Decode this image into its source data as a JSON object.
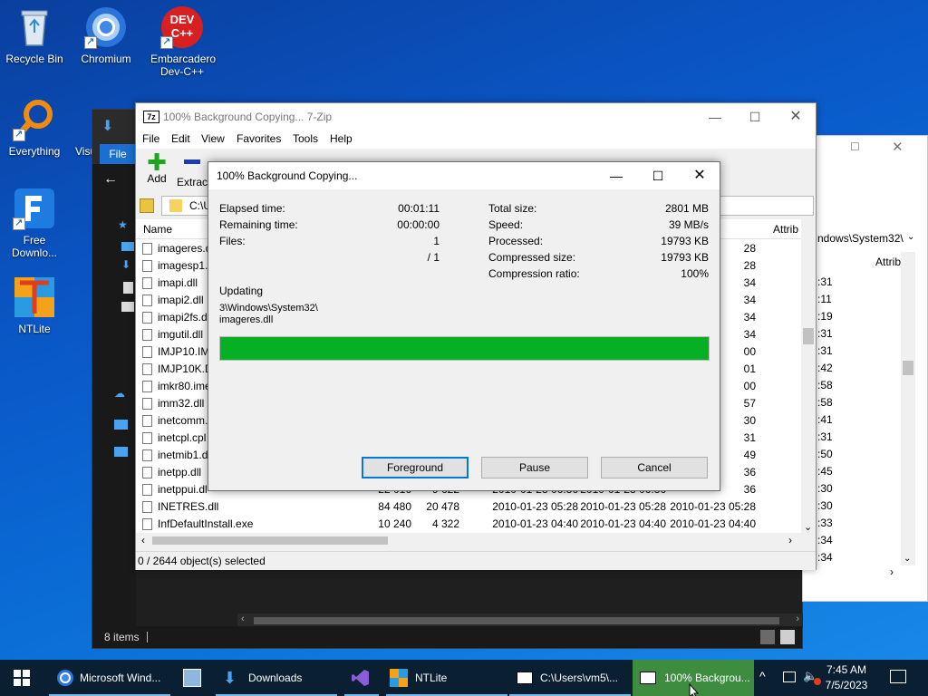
{
  "desktop": {
    "icons": [
      {
        "label": "Recycle Bin"
      },
      {
        "label": "Chromium"
      },
      {
        "label": "Embarcadero Dev-C++"
      },
      {
        "label": "Everything"
      },
      {
        "label": "Visu"
      },
      {
        "label": "Free Downlo..."
      },
      {
        "label": "NTLite"
      }
    ],
    "devcpp_logo_text": "DEV C++"
  },
  "explorer_dark": {
    "file_tab": "File",
    "status": "8 items"
  },
  "explorer_right": {
    "address_fragment": "ndows\\System32\\",
    "attrib_header": "Attrib",
    "times": [
      ":31",
      ":11",
      ":19",
      ":31",
      ":31",
      ":42",
      ":58",
      ":58",
      ":41",
      ":31",
      ":50",
      ":45",
      ":30",
      ":30",
      ":33",
      ":34",
      ":34"
    ]
  },
  "zip": {
    "title": "100% Background Copying... 7-Zip",
    "app_icon": "7z",
    "menu": [
      "File",
      "Edit",
      "View",
      "Favorites",
      "Tools",
      "Help"
    ],
    "toolbar": {
      "add": "Add",
      "extract": "Extract"
    },
    "address": "C:\\U",
    "columns": {
      "name": "Name",
      "attrib": "Attrib"
    },
    "rows": [
      {
        "name": "imageres.d",
        "size": "",
        "packed": "",
        "modified": "",
        "created": "",
        "accessed": "28"
      },
      {
        "name": "imagesp1.d",
        "size": "",
        "packed": "",
        "modified": "",
        "created": "",
        "accessed": "28"
      },
      {
        "name": "imapi.dll",
        "size": "",
        "packed": "",
        "modified": "",
        "created": "",
        "accessed": "34"
      },
      {
        "name": "imapi2.dll",
        "size": "",
        "packed": "",
        "modified": "",
        "created": "",
        "accessed": "34"
      },
      {
        "name": "imapi2fs.dl",
        "size": "",
        "packed": "",
        "modified": "",
        "created": "",
        "accessed": "34"
      },
      {
        "name": "imgutil.dll",
        "size": "",
        "packed": "",
        "modified": "",
        "created": "",
        "accessed": "34"
      },
      {
        "name": "IMJP10.IME",
        "size": "",
        "packed": "",
        "modified": "",
        "created": "",
        "accessed": "00"
      },
      {
        "name": "IMJP10K.DL",
        "size": "",
        "packed": "",
        "modified": "",
        "created": "",
        "accessed": "01"
      },
      {
        "name": "imkr80.ime",
        "size": "",
        "packed": "",
        "modified": "",
        "created": "",
        "accessed": "00"
      },
      {
        "name": "imm32.dll",
        "size": "",
        "packed": "",
        "modified": "",
        "created": "",
        "accessed": "57"
      },
      {
        "name": "inetcomm.",
        "size": "",
        "packed": "",
        "modified": "",
        "created": "",
        "accessed": "30"
      },
      {
        "name": "inetcpl.cpl",
        "size": "",
        "packed": "",
        "modified": "",
        "created": "",
        "accessed": "31"
      },
      {
        "name": "inetmib1.d",
        "size": "",
        "packed": "",
        "modified": "",
        "created": "",
        "accessed": "49"
      },
      {
        "name": "inetpp.dll",
        "size": "",
        "packed": "",
        "modified": "",
        "created": "",
        "accessed": "36"
      },
      {
        "name": "inetppui.dl",
        "size": "22 016",
        "packed": "9 622",
        "modified": "2010-01-23 06:36",
        "created": "2010-01-23 06:36",
        "accessed": "36"
      },
      {
        "name": "INETRES.dll",
        "size": "84 480",
        "packed": "20 478",
        "modified": "2010-01-23 05:28",
        "created": "2010-01-23 05:28",
        "accessed": "2010-01-23 05:28"
      },
      {
        "name": "InfDefaultInstall.exe",
        "size": "10 240",
        "packed": "4 322",
        "modified": "2010-01-23 04:40",
        "created": "2010-01-23 04:40",
        "accessed": "2010-01-23 04:40"
      }
    ],
    "status": "0 / 2644 object(s) selected"
  },
  "dialog": {
    "title": "100% Background Copying...",
    "left": [
      {
        "label": "Elapsed time:",
        "value": "00:01:11"
      },
      {
        "label": "Remaining time:",
        "value": "00:00:00"
      },
      {
        "label": "Files:",
        "value": "1"
      },
      {
        "label": "",
        "value": "/ 1"
      }
    ],
    "right": [
      {
        "label": "Total size:",
        "value": "2801 MB"
      },
      {
        "label": "Speed:",
        "value": "39 MB/s"
      },
      {
        "label": "Processed:",
        "value": "19793 KB"
      },
      {
        "label": "Compressed size:",
        "value": "19793 KB"
      },
      {
        "label": "Compression ratio:",
        "value": "100%"
      }
    ],
    "operation": "Updating",
    "path_line1": "3\\Windows\\System32\\",
    "path_line2": "imageres.dll",
    "progress": 1.0,
    "progress_color": "#06b025",
    "buttons": {
      "foreground": "Foreground",
      "pause": "Pause",
      "cancel": "Cancel"
    }
  },
  "taskbar": {
    "items": [
      {
        "label": "Microsoft Wind...",
        "icon": "chromium-icon"
      },
      {
        "label": "",
        "icon": "network-settings-icon"
      },
      {
        "label": "Downloads",
        "icon": "download-folder-icon"
      },
      {
        "label": "",
        "icon": "visual-studio-icon"
      },
      {
        "label": "NTLite",
        "icon": "ntlite-icon"
      },
      {
        "label": "C:\\Users\\vm5\\...",
        "icon": "7zip-icon"
      },
      {
        "label": "100% Backgrou...",
        "icon": "7zip-icon"
      }
    ],
    "time": "7:45 AM",
    "date": "7/5/2023",
    "accent": "#3d8c40"
  }
}
